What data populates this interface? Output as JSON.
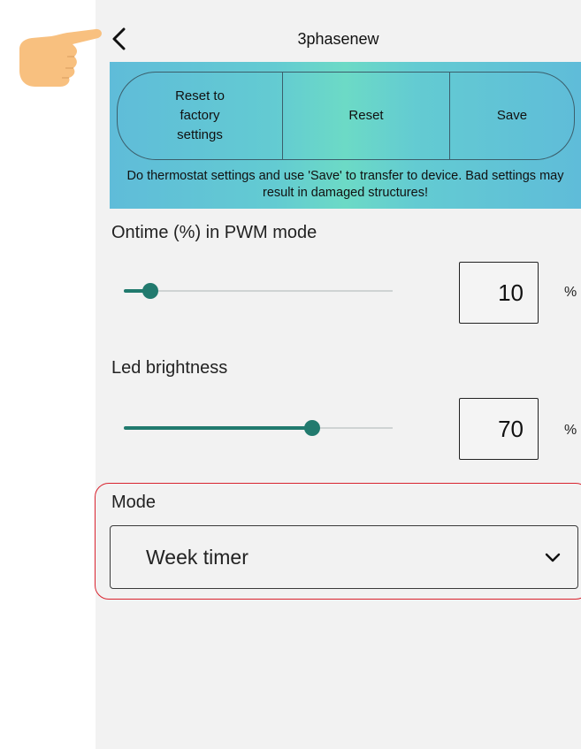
{
  "header": {
    "title": "3phasenew",
    "back_icon": "chevron-left-icon"
  },
  "annotation": {
    "pointer_icon": "pointing-hand-icon",
    "pointer_color": "#f8c07f",
    "highlight_color": "#d9232e"
  },
  "banner": {
    "buttons": {
      "reset_factory": "Reset to\nfactory\nsettings",
      "reset": "Reset",
      "save": "Save"
    },
    "warning": "Do thermostat settings and use 'Save' to transfer to device. Bad settings may result in damaged structures!"
  },
  "settings": {
    "ontime": {
      "label": "Ontime (%) in PWM mode",
      "value": "10",
      "unit": "%",
      "slider_fraction": 0.1
    },
    "led": {
      "label": "Led brightness",
      "value": "70",
      "unit": "%",
      "slider_fraction": 0.7
    }
  },
  "mode": {
    "label": "Mode",
    "selected": "Week timer",
    "dropdown_icon": "chevron-down-icon"
  },
  "colors": {
    "accent": "#217a6e",
    "banner_start": "#5fbcd9",
    "banner_mid": "#6cdac6"
  }
}
